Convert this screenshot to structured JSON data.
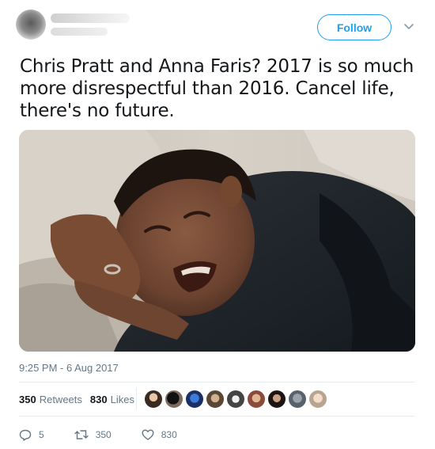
{
  "header": {
    "follow_label": "Follow",
    "caret_icon": "chevron-down-icon"
  },
  "tweet": {
    "text": "Chris Pratt and Anna Faris? 2017 is so much more disrespectful than 2016. Cancel life, there's no future.",
    "timestamp": "9:25 PM - 6 Aug 2017"
  },
  "stats": {
    "retweets_count": "350",
    "retweets_label": "Retweets",
    "likes_count": "830",
    "likes_label": "Likes"
  },
  "liker_avatars": [
    "avatar-1",
    "avatar-2",
    "avatar-3",
    "avatar-4",
    "avatar-5",
    "avatar-6",
    "avatar-7",
    "avatar-8",
    "avatar-9"
  ],
  "actions": {
    "reply_count": "5",
    "retweet_count": "350",
    "like_count": "830"
  },
  "colors": {
    "accent": "#1da1f2",
    "secondary_text": "#657786",
    "divider": "#e6ecf0"
  }
}
